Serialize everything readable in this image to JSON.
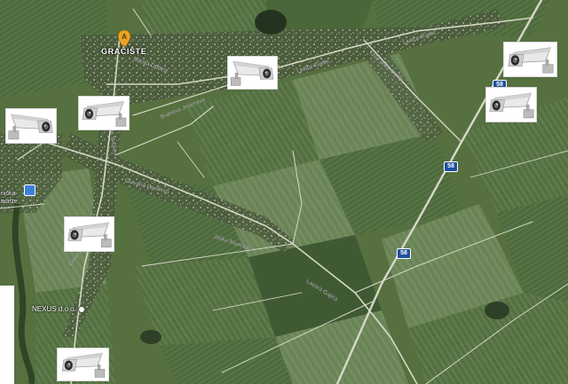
{
  "map": {
    "type": "satellite",
    "place_label": "GRAČIŠTE",
    "small_place_label": "nička\nadište",
    "poi_label": "NEXUS d.o.o.",
    "markers": [
      {
        "name": "place-pin",
        "color": "#e8a326",
        "letter": "A"
      }
    ],
    "route_shields": [
      {
        "label": "58"
      },
      {
        "label": "58"
      },
      {
        "label": "58"
      }
    ],
    "road_labels": [
      "Ljutice Radie",
      "Ljutice Radie",
      "Miloša Obilića",
      "Bratstva Jedinstva",
      "Sakana Vučkovića",
      "Glavana Danilova",
      "Joška Mijatovića",
      "Lazara Gajića",
      "Triše Jovanovića",
      "Čilice Pavlovića"
    ],
    "cameras": [
      {
        "name": "camera-1",
        "icon": "cctv-camera-icon"
      },
      {
        "name": "camera-2",
        "icon": "cctv-camera-icon"
      },
      {
        "name": "camera-3",
        "icon": "cctv-camera-icon"
      },
      {
        "name": "camera-4",
        "icon": "cctv-camera-icon"
      },
      {
        "name": "camera-5",
        "icon": "cctv-camera-icon"
      },
      {
        "name": "camera-6",
        "icon": "cctv-camera-icon"
      },
      {
        "name": "camera-7",
        "icon": "cctv-camera-icon"
      }
    ],
    "colors": {
      "field_dark": "#3f5a33",
      "field_mid": "#5d7a4a",
      "field_light": "#7b9462",
      "road": "#d7d8c9",
      "shield": "#1d4f9c"
    }
  }
}
